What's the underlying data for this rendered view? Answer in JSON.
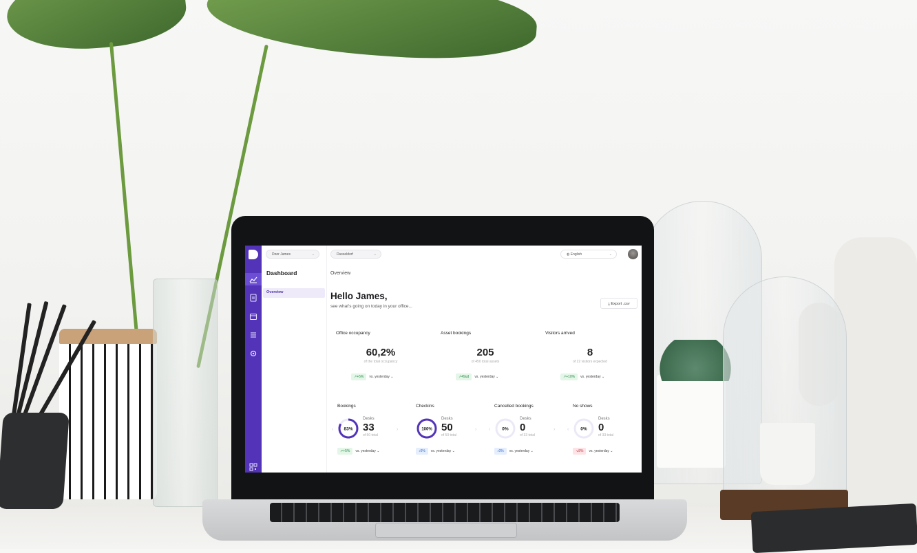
{
  "topbar": {
    "user_select": "Door James",
    "location_select": "Dusseldorf",
    "language_select": "English"
  },
  "sidebar": {
    "section_title": "Dashboard",
    "items": [
      {
        "label": "Overview"
      }
    ]
  },
  "rail_icons": [
    "logo-icon",
    "chart-icon",
    "document-icon",
    "calendar-icon",
    "list-icon",
    "settings-icon",
    "qr-icon"
  ],
  "main": {
    "breadcrumb": "Overview",
    "greeting": "Hello James,",
    "subtitle": "see what's going on today in your office...",
    "export_label": "Export .csv"
  },
  "stats": [
    {
      "title": "Office occupancy",
      "value": "60,2%",
      "sub": "of the total occupancy",
      "trend": "+5%",
      "trend_type": "up",
      "compare": "vs. yesterday"
    },
    {
      "title": "Asset bookings",
      "value": "205",
      "sub": "of 450 total assets",
      "trend": "49ud",
      "trend_type": "up",
      "compare": "vs. yesterday"
    },
    {
      "title": "Visitors arrived",
      "value": "8",
      "sub": "of 22 visitors expected",
      "trend": "+10%",
      "trend_type": "up",
      "compare": "vs. yesterday"
    }
  ],
  "bookings": [
    {
      "title": "Bookings",
      "category": "Desks",
      "value": "33",
      "sub": "of 50 total",
      "percent": 83,
      "percent_label": "83%",
      "trend": "+5%",
      "trend_type": "up",
      "compare": "vs. yesterday"
    },
    {
      "title": "Checkins",
      "category": "Desks",
      "value": "50",
      "sub": "of 50 total",
      "percent": 100,
      "percent_label": "100%",
      "trend": "0%",
      "trend_type": "flat",
      "compare": "vs. yesterday"
    },
    {
      "title": "Cancelled bookings",
      "category": "Desks",
      "value": "0",
      "sub": "of 33 total",
      "percent": 0,
      "percent_label": "0%",
      "trend": "0%",
      "trend_type": "flat",
      "compare": "vs. yesterday"
    },
    {
      "title": "No shows",
      "category": "Desks",
      "value": "0",
      "sub": "of 33 total",
      "percent": 0,
      "percent_label": "0%",
      "trend": "8%",
      "trend_type": "down",
      "compare": "vs. yesterday"
    }
  ],
  "colors": {
    "brand": "#5334b8",
    "up": "#2f8c4b",
    "flat": "#3b6cc9",
    "down": "#c83b4c"
  }
}
